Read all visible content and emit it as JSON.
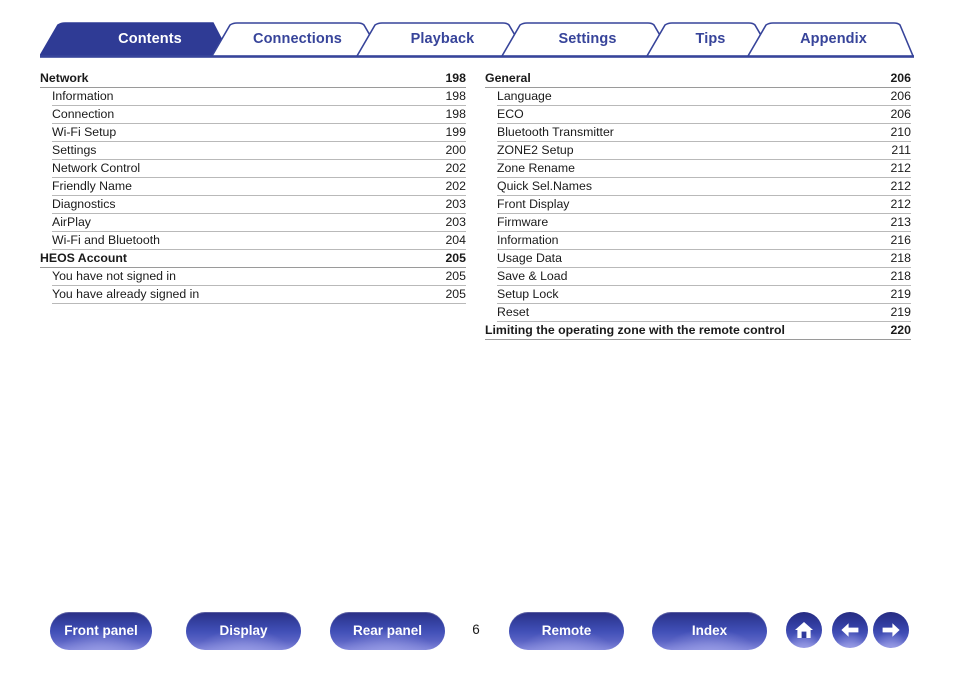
{
  "document": {
    "page_number": "6",
    "accent_color": "#37449a",
    "active_tab_fill": "#2f3b95"
  },
  "tabs": [
    {
      "label": "Contents",
      "active": true
    },
    {
      "label": "Connections",
      "active": false
    },
    {
      "label": "Playback",
      "active": false
    },
    {
      "label": "Settings",
      "active": false
    },
    {
      "label": "Tips",
      "active": false
    },
    {
      "label": "Appendix",
      "active": false
    }
  ],
  "toc": {
    "left_column": [
      {
        "title": "Network",
        "page": "198",
        "level": "head"
      },
      {
        "title": "Information",
        "page": "198",
        "level": "sub"
      },
      {
        "title": "Connection",
        "page": "198",
        "level": "sub"
      },
      {
        "title": "Wi-Fi Setup",
        "page": "199",
        "level": "sub"
      },
      {
        "title": "Settings",
        "page": "200",
        "level": "sub"
      },
      {
        "title": "Network Control",
        "page": "202",
        "level": "sub"
      },
      {
        "title": "Friendly Name",
        "page": "202",
        "level": "sub"
      },
      {
        "title": "Diagnostics",
        "page": "203",
        "level": "sub"
      },
      {
        "title": "AirPlay",
        "page": "203",
        "level": "sub"
      },
      {
        "title": "Wi-Fi and Bluetooth",
        "page": "204",
        "level": "sub"
      },
      {
        "title": "HEOS Account",
        "page": "205",
        "level": "head"
      },
      {
        "title": "You have not signed in",
        "page": "205",
        "level": "sub"
      },
      {
        "title": "You have already signed in",
        "page": "205",
        "level": "sub"
      }
    ],
    "right_column": [
      {
        "title": "General",
        "page": "206",
        "level": "head"
      },
      {
        "title": "Language",
        "page": "206",
        "level": "sub"
      },
      {
        "title": "ECO",
        "page": "206",
        "level": "sub"
      },
      {
        "title": "Bluetooth Transmitter",
        "page": "210",
        "level": "sub"
      },
      {
        "title": "ZONE2 Setup",
        "page": "211",
        "level": "sub"
      },
      {
        "title": "Zone Rename",
        "page": "212",
        "level": "sub"
      },
      {
        "title": "Quick Sel.Names",
        "page": "212",
        "level": "sub"
      },
      {
        "title": "Front Display",
        "page": "212",
        "level": "sub"
      },
      {
        "title": "Firmware",
        "page": "213",
        "level": "sub"
      },
      {
        "title": "Information",
        "page": "216",
        "level": "sub"
      },
      {
        "title": "Usage Data",
        "page": "218",
        "level": "sub"
      },
      {
        "title": "Save & Load",
        "page": "218",
        "level": "sub"
      },
      {
        "title": "Setup Lock",
        "page": "219",
        "level": "sub"
      },
      {
        "title": "Reset",
        "page": "219",
        "level": "sub"
      },
      {
        "title": "Limiting the operating zone with the remote control",
        "page": "220",
        "level": "head"
      }
    ]
  },
  "footer": {
    "buttons": [
      {
        "label": "Front panel",
        "icon": "front-panel"
      },
      {
        "label": "Display",
        "icon": "display"
      },
      {
        "label": "Rear panel",
        "icon": "rear-panel"
      },
      {
        "label": "Remote",
        "icon": "remote"
      },
      {
        "label": "Index",
        "icon": "index"
      }
    ],
    "icon_buttons": [
      {
        "icon": "home-icon"
      },
      {
        "icon": "arrow-left-icon"
      },
      {
        "icon": "arrow-right-icon"
      }
    ],
    "page_number": "6"
  }
}
